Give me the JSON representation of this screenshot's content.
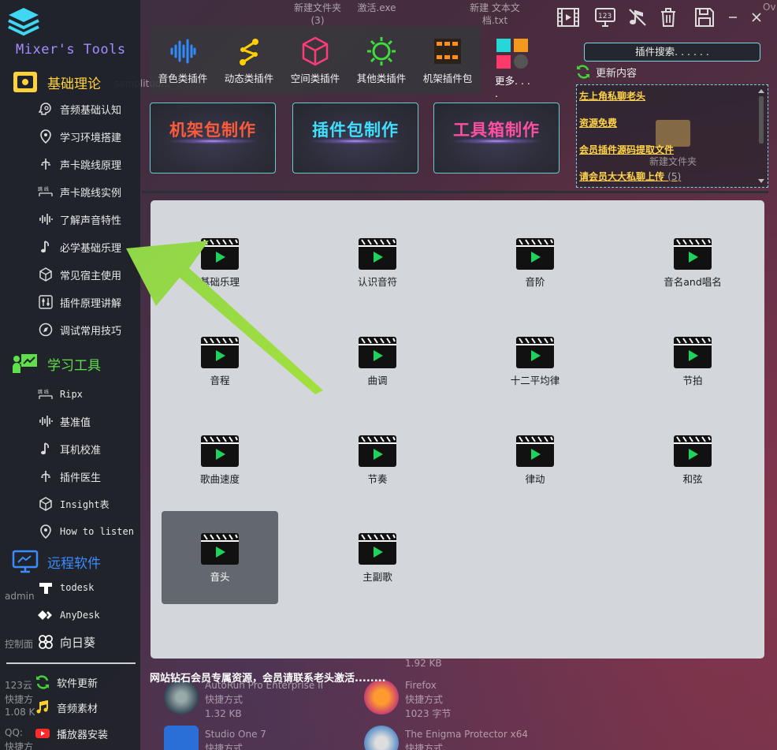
{
  "app": {
    "logo_text": "Mixer's Tools"
  },
  "sidebar": {
    "sections": [
      {
        "label": "基础理论",
        "color": "#ffd23c"
      },
      {
        "label": "学习工具",
        "color": "#5fe04a"
      },
      {
        "label": "远程软件",
        "color": "#3a8cff"
      }
    ],
    "theory_items": [
      {
        "label": "音频基础认知",
        "icon": "brain-gear-icon"
      },
      {
        "label": "学习环境搭建",
        "icon": "location-pin-icon"
      },
      {
        "label": "声卡跳线原理",
        "icon": "connector-icon"
      },
      {
        "label": "声卡跳线实例",
        "icon": "patch-icon"
      },
      {
        "label": "了解声音特性",
        "icon": "waveform-icon"
      },
      {
        "label": "必学基础乐理",
        "icon": "music-note-icon"
      },
      {
        "label": "常见宿主使用",
        "icon": "cube-icon"
      },
      {
        "label": "插件原理讲解",
        "icon": "sliders-icon"
      },
      {
        "label": "调试常用技巧",
        "icon": "compass-icon"
      }
    ],
    "tool_items": [
      {
        "label": "Ripx",
        "icon": "patch-icon"
      },
      {
        "label": "基准值",
        "icon": "waveform-icon"
      },
      {
        "label": "耳机校准",
        "icon": "music-note-icon"
      },
      {
        "label": "插件医生",
        "icon": "connector-icon"
      },
      {
        "label": "Insight表",
        "icon": "cube-icon"
      },
      {
        "label": "How to listen",
        "icon": "location-pin-icon"
      }
    ],
    "remote_items": [
      {
        "label": "todesk",
        "icon": "todesk-icon"
      },
      {
        "label": "AnyDesk",
        "icon": "anydesk-icon"
      },
      {
        "label": "向日葵",
        "icon": "sunflower-icon"
      }
    ],
    "bottom_items": [
      {
        "label": "软件更新",
        "icon": "refresh-icon"
      },
      {
        "label": "音频素材",
        "icon": "music-note-icon"
      },
      {
        "label": "播放器安装",
        "icon": "youtube-play-icon"
      }
    ]
  },
  "toolbar": {
    "categories": [
      {
        "label": "音色类插件",
        "icon": "waveform-icon",
        "color": "#2f8cff"
      },
      {
        "label": "动态类插件",
        "icon": "nodes-icon",
        "color": "#ffd000"
      },
      {
        "label": "空间类插件",
        "icon": "cube-icon",
        "color": "#ff3b7a"
      },
      {
        "label": "其他类插件",
        "icon": "sun-icon",
        "color": "#3fdc3f"
      },
      {
        "label": "机架插件包",
        "icon": "rack-icon",
        "color": "#ff9020"
      }
    ],
    "more_label": "更多. . . ."
  },
  "desktop": {
    "file1_line1": "新建文件夹",
    "file1_line2": "(3)",
    "file2": "激活.exe",
    "file3_line1": "新建 文本文",
    "file3_line2": "档.txt",
    "edge_text": "Ov",
    "ghost_folder": "新建文件夹",
    "sampl": "samplitud...",
    "bottom_files": [
      {
        "name": "AutoRun Pro Enterprise II",
        "type": "快捷方式",
        "size": "1.32 KB"
      },
      {
        "name": "Firefox",
        "type": "快捷方式",
        "size": "1023 字节"
      },
      {
        "name": "Studio One 7",
        "type": "快捷方式",
        "size": ""
      },
      {
        "name": "The Enigma Protector x64",
        "type": "快捷方式",
        "size": ""
      }
    ],
    "size_top": "1.92 KB",
    "left_ghosts": [
      "admin",
      "控制面",
      "123云",
      "快捷方",
      "1.08 K",
      "QQ:",
      "快捷方"
    ]
  },
  "search": {
    "label": "插件搜索. . . . . ."
  },
  "update": {
    "label": "更新内容"
  },
  "news": [
    {
      "text": "左上角私聊老头",
      "count": ""
    },
    {
      "text": "资源免费",
      "count": ""
    },
    {
      "text": "会员插件源码提取文件",
      "count": ""
    },
    {
      "text": "请会员大大私聊上传",
      "count": "(5)"
    }
  ],
  "make_buttons": [
    {
      "label": "机架包制作",
      "color": "#ff5a3c"
    },
    {
      "label": "插件包制作",
      "color": "#3fe0ff"
    },
    {
      "label": "工具箱制作",
      "color": "#ff4fa3"
    }
  ],
  "videos": [
    "基础乐理",
    "认识音符",
    "音阶",
    "音名and唱名",
    "音程",
    "曲调",
    "十二平均律",
    "节拍",
    "歌曲速度",
    "节奏",
    "律动",
    "和弦",
    "音头",
    "主副歌"
  ],
  "selected_video": "音头",
  "footer_note": "网站钻石会员专属资源，会员请联系老头激活........"
}
